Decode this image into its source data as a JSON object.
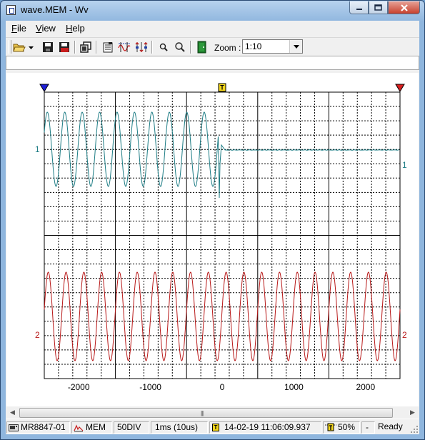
{
  "window": {
    "title": "wave.MEM - Wv"
  },
  "menu": [
    "File",
    "View",
    "Help"
  ],
  "toolbar": {
    "buttons": [
      "open-icon",
      "save-icon",
      "save-as-icon",
      "copy-icon",
      "properties-icon",
      "cursor-icon",
      "channel-settings-icon",
      "zoom-in-icon",
      "zoom-out-icon",
      "exit-icon"
    ],
    "zoom_label": "Zoom :",
    "zoom_value": "1:10"
  },
  "plot": {
    "trigger_marker": "T",
    "ch1_label": "1",
    "ch2_label": "2",
    "colors": {
      "ch1": "#1e7d85",
      "ch2": "#b81818",
      "start_marker": "#1f1fd8",
      "end_marker": "#d81f1f",
      "trigger_marker": "#f2d51c"
    }
  },
  "chart_data": {
    "type": "line",
    "x_tick_labels": [
      "-2000",
      "-1000",
      "0",
      "1000",
      "2000"
    ],
    "xlim": [
      -2480,
      2480
    ],
    "x_units": "ms",
    "grid": true,
    "series": [
      {
        "channel": "1",
        "description": "sinusoid until collapse just before trigger, then settles to flat baseline",
        "cycles_before_trigger": 10,
        "collapse_at": -50
      },
      {
        "channel": "2",
        "description": "continuous sinusoid",
        "cycles": 20
      }
    ]
  },
  "status": {
    "device": "MR8847-01",
    "mode": "MEM",
    "length": "50DIV",
    "timebase": "1ms (10us)",
    "trigger_marker": "T",
    "trigger_time": "14-02-19 11:06:09.937",
    "pretrigger": "50%",
    "dash": "-",
    "state": "Ready"
  }
}
